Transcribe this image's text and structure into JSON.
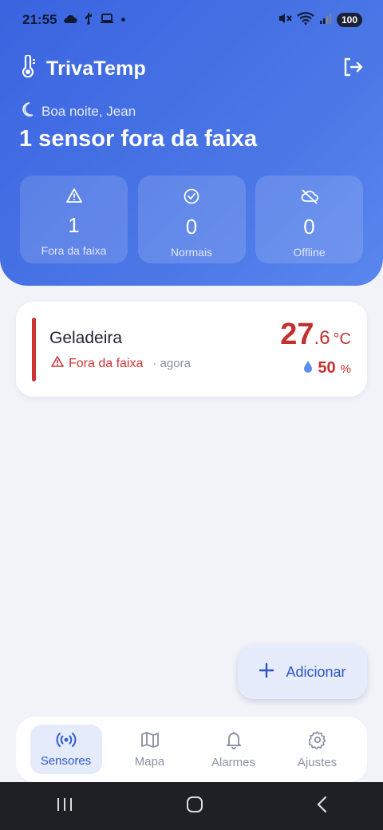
{
  "status_bar": {
    "time": "21:55",
    "battery": "100",
    "dot": "•"
  },
  "app": {
    "name": "TrivaTemp"
  },
  "greeting": "Boa noite, Jean",
  "headline": "1 sensor fora da faixa",
  "stats": [
    {
      "icon": "warning-triangle-icon",
      "value": "1",
      "label": "Fora da faixa"
    },
    {
      "icon": "check-circle-icon",
      "value": "0",
      "label": "Normais"
    },
    {
      "icon": "cloud-off-icon",
      "value": "0",
      "label": "Offline"
    }
  ],
  "sensor": {
    "name": "Geladeira",
    "status": "Fora da faixa",
    "when": "· agora",
    "temp_int": "27",
    "temp_dec": ".6",
    "temp_unit": "°C",
    "humidity": "50",
    "humidity_unit": "%"
  },
  "fab": {
    "label": "Adicionar"
  },
  "nav": [
    {
      "icon": "sensor-broadcast-icon",
      "label": "Sensores",
      "active": true
    },
    {
      "icon": "map-icon",
      "label": "Mapa"
    },
    {
      "icon": "bell-icon",
      "label": "Alarmes"
    },
    {
      "icon": "gear-icon",
      "label": "Ajustes"
    }
  ],
  "colors": {
    "primary": "#3a64e0",
    "alert": "#cc3333",
    "background": "#f1f3f8"
  }
}
